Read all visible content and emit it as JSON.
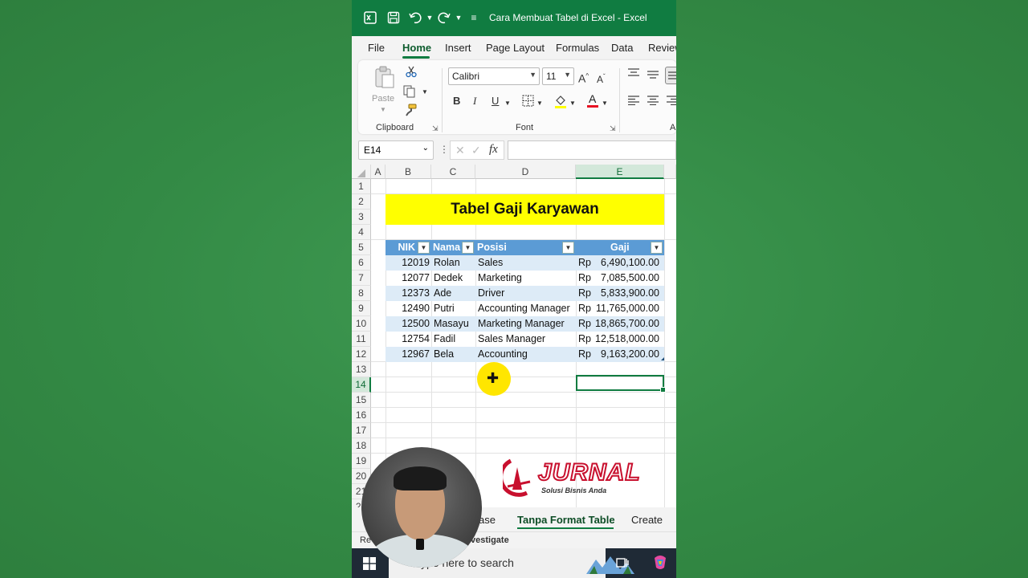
{
  "window": {
    "title": "Cara Membuat Tabel di Excel  -  Excel"
  },
  "ribbon_tabs": [
    "File",
    "Home",
    "Insert",
    "Page Layout",
    "Formulas",
    "Data",
    "Review"
  ],
  "ribbon": {
    "clipboard": {
      "paste_label": "Paste",
      "group_label": "Clipboard"
    },
    "font": {
      "family": "Calibri",
      "size": "11",
      "group_label": "Font",
      "bold": "B",
      "italic": "I",
      "underline": "U"
    },
    "alignment": {
      "group_label": "A"
    }
  },
  "formula_bar": {
    "name_box": "E14",
    "fx": "fx",
    "formula": ""
  },
  "columns": [
    "A",
    "B",
    "C",
    "D",
    "E"
  ],
  "rows": [
    "1",
    "2",
    "3",
    "4",
    "5",
    "6",
    "7",
    "8",
    "9",
    "10",
    "11",
    "12",
    "13",
    "14",
    "15",
    "16",
    "17",
    "18",
    "19",
    "20",
    "21",
    "22"
  ],
  "sheet": {
    "banner": "Tabel Gaji Karyawan",
    "headers": {
      "nik": "NIK",
      "nama": "Nama",
      "posisi": "Posisi",
      "gaji": "Gaji"
    },
    "currency": "Rp",
    "records": [
      {
        "nik": "12019",
        "nama": "Rolan",
        "posisi": "Sales",
        "gaji": "6,490,100.00"
      },
      {
        "nik": "12077",
        "nama": "Dedek",
        "posisi": "Marketing",
        "gaji": "7,085,500.00"
      },
      {
        "nik": "12373",
        "nama": "Ade",
        "posisi": "Driver",
        "gaji": "5,833,900.00"
      },
      {
        "nik": "12490",
        "nama": "Putri",
        "posisi": "Accounting Manager",
        "gaji": "11,765,000.00"
      },
      {
        "nik": "12500",
        "nama": "Masayu",
        "posisi": "Marketing Manager",
        "gaji": "18,865,700.00"
      },
      {
        "nik": "12754",
        "nama": "Fadil",
        "posisi": "Sales Manager",
        "gaji": "12,518,000.00"
      },
      {
        "nik": "12967",
        "nama": "Bela",
        "posisi": "Accounting",
        "gaji": "9,163,200.00"
      }
    ]
  },
  "logo": {
    "name": "JURNAL",
    "tagline": "Solusi Bisnis Anda"
  },
  "sheet_tabs": {
    "partial": "ase",
    "active": "Tanpa Format Table",
    "next": "Create"
  },
  "status_bar": {
    "left": "Re",
    "investigate": "vestigate"
  },
  "taskbar": {
    "search_placeholder": "ype here to search"
  },
  "colors": {
    "excel_green": "#107c41",
    "table_header": "#5b9bd5",
    "band": "#ddebf7",
    "banner": "#ffff00"
  }
}
